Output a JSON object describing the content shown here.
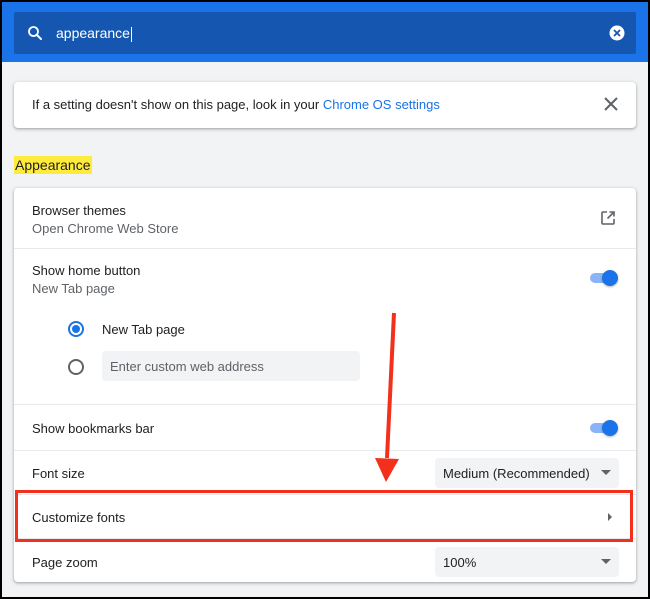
{
  "search": {
    "value": "appearance"
  },
  "info": {
    "text": "If a setting doesn't show on this page, look in your ",
    "link": "Chrome OS settings"
  },
  "section": {
    "title": "Appearance"
  },
  "settings": {
    "themes": {
      "label": "Browser themes",
      "sublabel": "Open Chrome Web Store"
    },
    "home_button": {
      "label": "Show home button",
      "sublabel": "New Tab page",
      "enabled": true,
      "options": [
        {
          "label": "New Tab page",
          "selected": true
        }
      ],
      "custom_placeholder": "Enter custom web address"
    },
    "bookmarks_bar": {
      "label": "Show bookmarks bar",
      "enabled": true
    },
    "font_size": {
      "label": "Font size",
      "value": "Medium (Recommended)"
    },
    "customize_fonts": {
      "label": "Customize fonts"
    },
    "page_zoom": {
      "label": "Page zoom",
      "value": "100%"
    }
  },
  "colors": {
    "header": "#1a73e8",
    "search_field": "#1557b0",
    "accent": "#1a73e8",
    "highlight": "#ffeb3b",
    "annotation": "#f2301b"
  },
  "icons": [
    "search-icon",
    "clear-icon",
    "close-icon",
    "open-external-icon",
    "submenu-arrow-icon"
  ]
}
